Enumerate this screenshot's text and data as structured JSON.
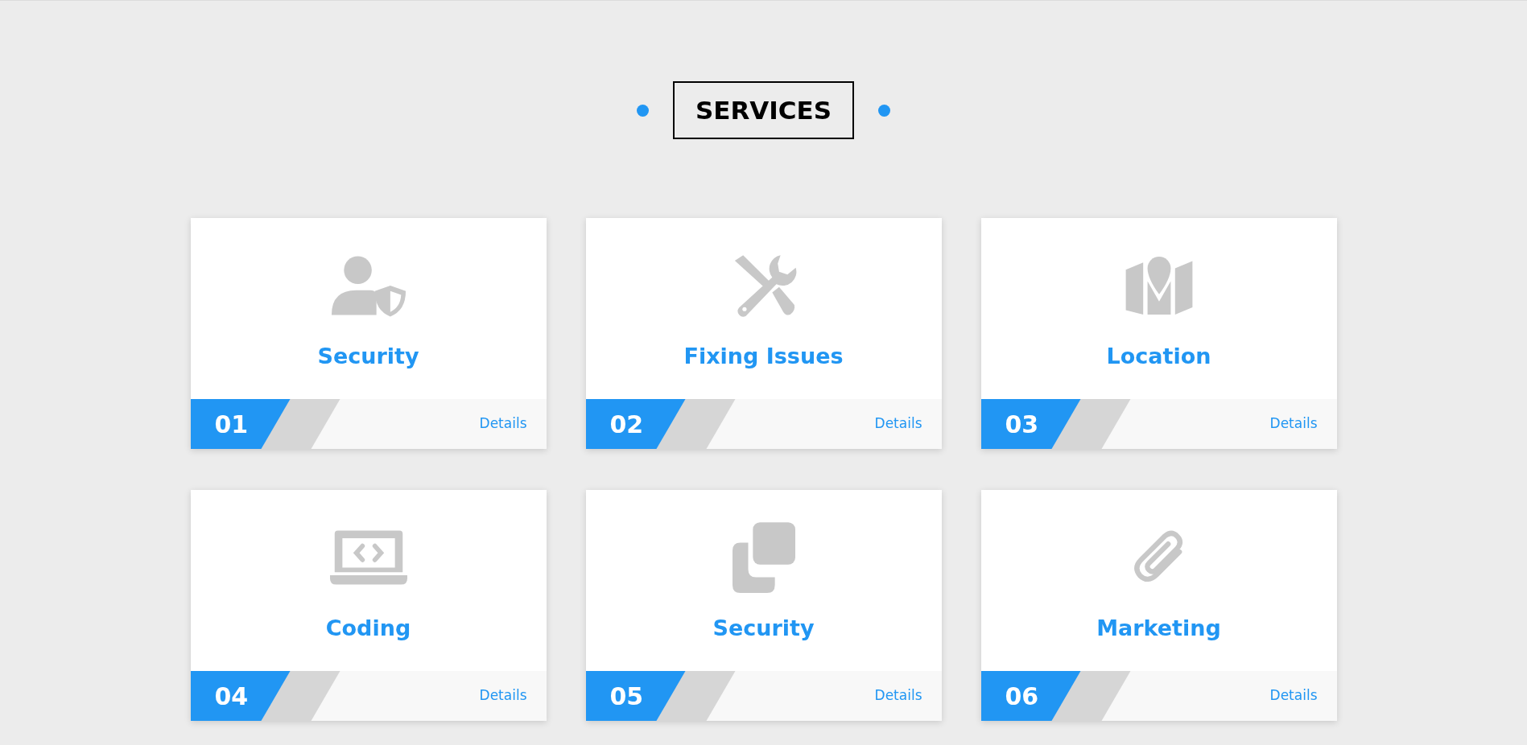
{
  "heading": "SERVICES",
  "services": [
    {
      "title": "Security",
      "number": "01",
      "link": "Details"
    },
    {
      "title": "Fixing Issues",
      "number": "02",
      "link": "Details"
    },
    {
      "title": "Location",
      "number": "03",
      "link": "Details"
    },
    {
      "title": "Coding",
      "number": "04",
      "link": "Details"
    },
    {
      "title": "Security",
      "number": "05",
      "link": "Details"
    },
    {
      "title": "Marketing",
      "number": "06",
      "link": "Details"
    }
  ]
}
